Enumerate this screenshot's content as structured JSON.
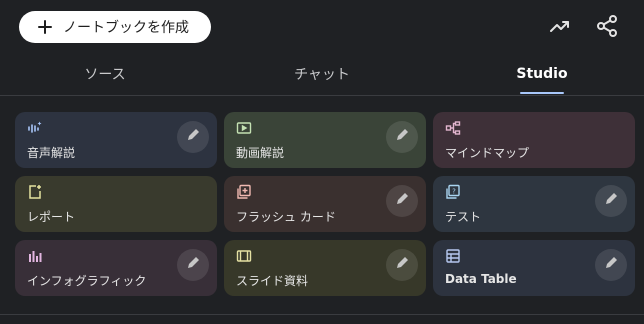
{
  "header": {
    "new_notebook_label": "ノートブックを作成"
  },
  "tabs": [
    {
      "label": "ソース"
    },
    {
      "label": "チャット"
    },
    {
      "label": "Studio"
    }
  ],
  "cards": [
    {
      "label": "音声解説",
      "icon": "audio-sparkle-icon",
      "color": "#2d3340",
      "accent": "#a8c7fa",
      "editable": true
    },
    {
      "label": "動画解説",
      "icon": "video-icon",
      "color": "#3a4438",
      "accent": "#c4e1b3",
      "editable": true
    },
    {
      "label": "マインドマップ",
      "icon": "mindmap-icon",
      "color": "#3e3038",
      "accent": "#e3b6cf",
      "editable": false
    },
    {
      "label": "レポート",
      "icon": "report-icon",
      "color": "#393a2d",
      "accent": "#e6e3a0",
      "editable": false
    },
    {
      "label": "フラッシュ カード",
      "icon": "flashcard-icon",
      "color": "#3a302f",
      "accent": "#f0b9b1",
      "editable": true
    },
    {
      "label": "テスト",
      "icon": "quiz-icon",
      "color": "#2e3640",
      "accent": "#a9d4f0",
      "editable": true
    },
    {
      "label": "インフォグラフィック",
      "icon": "infographic-icon",
      "color": "#382f38",
      "accent": "#e2b6e0",
      "editable": true
    },
    {
      "label": "スライド資料",
      "icon": "slides-icon",
      "color": "#373829",
      "accent": "#e5e1a3",
      "editable": true
    },
    {
      "label": "Data Table",
      "icon": "table-icon",
      "color": "#2d333f",
      "accent": "#b6c8f0",
      "editable": true
    }
  ]
}
